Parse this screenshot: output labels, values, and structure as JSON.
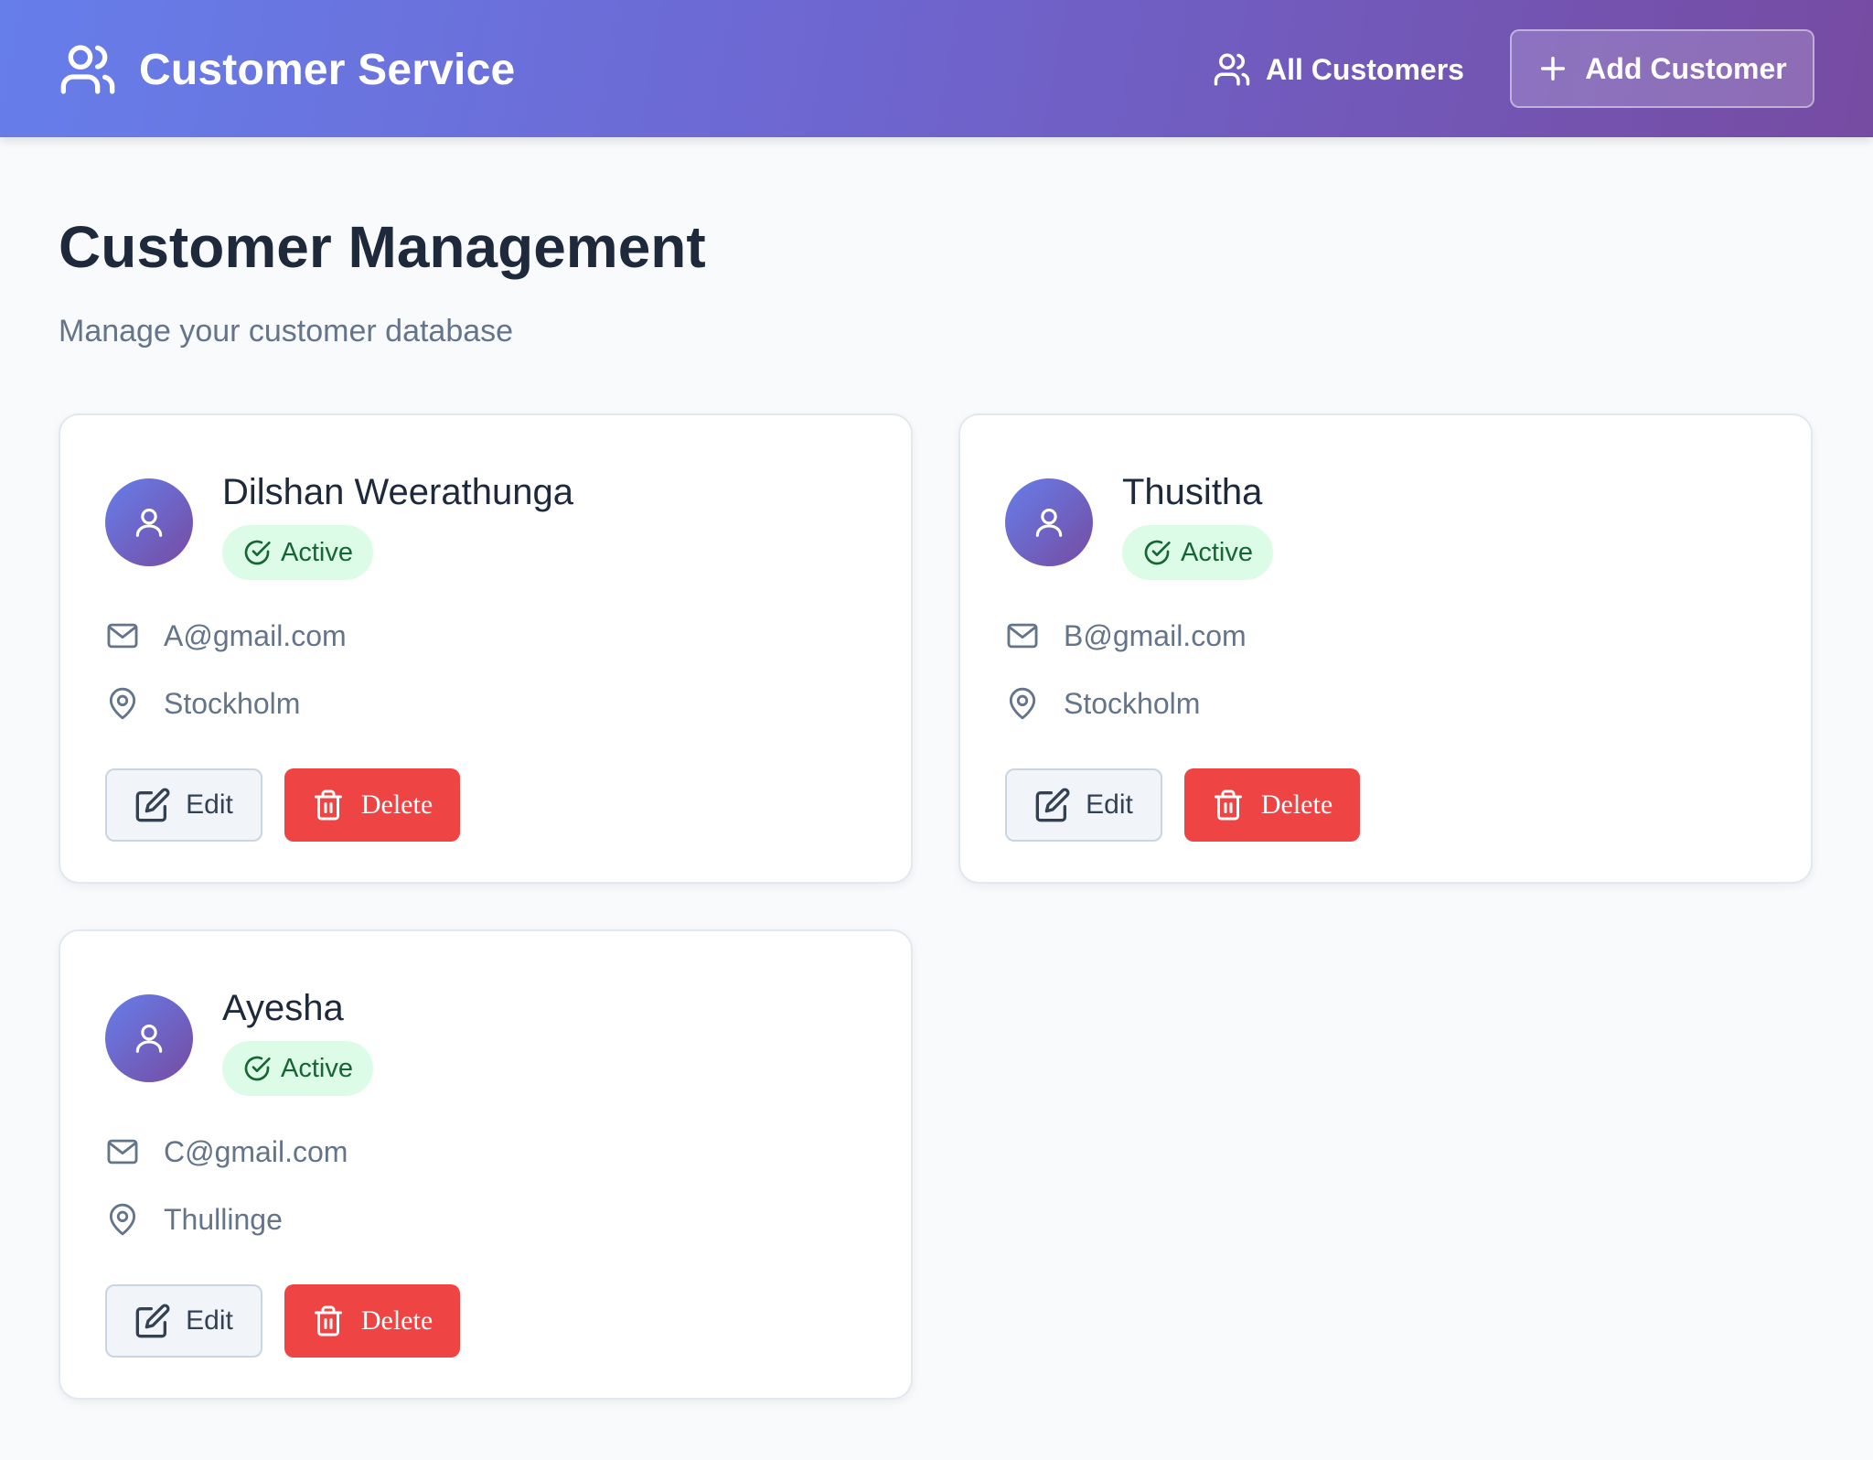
{
  "header": {
    "app_title": "Customer Service",
    "nav_all_customers": "All Customers",
    "add_customer_label": "Add Customer"
  },
  "page": {
    "title": "Customer Management",
    "subtitle": "Manage your customer database"
  },
  "customers": [
    {
      "name": "Dilshan Weerathunga",
      "status": "Active",
      "email": "A@gmail.com",
      "city": "Stockholm",
      "edit_label": "Edit",
      "delete_label": "Delete"
    },
    {
      "name": "Thusitha",
      "status": "Active",
      "email": "B@gmail.com",
      "city": "Stockholm",
      "edit_label": "Edit",
      "delete_label": "Delete"
    },
    {
      "name": "Ayesha",
      "status": "Active",
      "email": "C@gmail.com",
      "city": "Thullinge",
      "edit_label": "Edit",
      "delete_label": "Delete"
    }
  ],
  "icons": {
    "brand": "users-icon",
    "nav": "users-icon",
    "add": "plus-icon",
    "avatar": "user-icon",
    "status": "check-circle-icon",
    "email": "mail-icon",
    "city": "map-pin-icon",
    "edit": "edit-icon",
    "delete": "trash-icon"
  },
  "colors": {
    "header_gradient_start": "#667eea",
    "header_gradient_end": "#764ba2",
    "status_active_bg": "#dcfce7",
    "status_active_text": "#166534",
    "delete_bg": "#ef4444"
  }
}
